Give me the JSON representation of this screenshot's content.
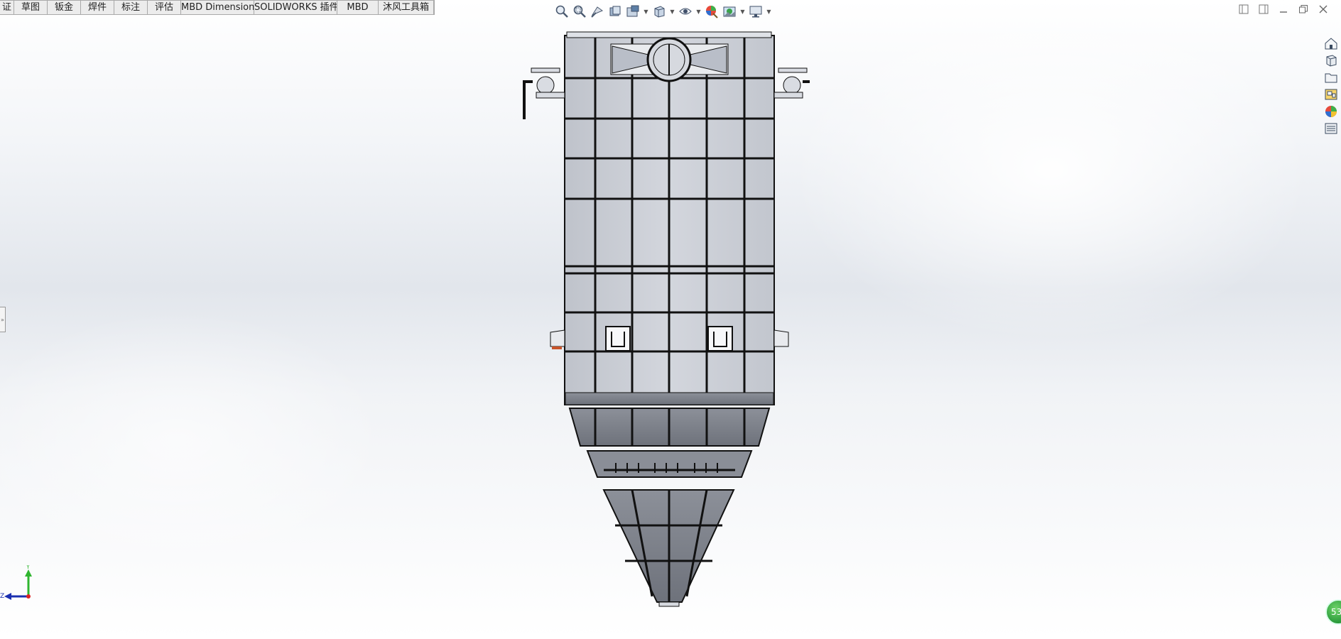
{
  "command_tabs": [
    {
      "label": "证",
      "width": 20
    },
    {
      "label": "草图",
      "width": 47
    },
    {
      "label": "钣金",
      "width": 47
    },
    {
      "label": "焊件",
      "width": 47
    },
    {
      "label": "标注",
      "width": 47
    },
    {
      "label": "评估",
      "width": 47
    },
    {
      "label": "MBD Dimensions",
      "width": 103
    },
    {
      "label": "SOLIDWORKS 插件",
      "width": 117
    },
    {
      "label": "MBD",
      "width": 58
    },
    {
      "label": "沐风工具箱",
      "width": 78
    }
  ],
  "view_toolbar": {
    "icons": [
      "zoom-to-fit-icon",
      "zoom-to-area-icon",
      "previous-view-icon",
      "section-view-icon",
      "dynamic-annotation-icon",
      "view-orientation-icon",
      "display-style-icon",
      "hide-show-items-icon",
      "edit-appearance-icon",
      "apply-scene-icon",
      "view-settings-icon"
    ]
  },
  "window_controls": [
    "restore-left-icon",
    "restore-right-icon",
    "minimize-icon",
    "maximize-icon",
    "close-icon"
  ],
  "task_pane": [
    "solidworks-resources-icon",
    "design-library-icon",
    "file-explorer-icon",
    "view-palette-icon",
    "appearances-icon",
    "custom-properties-icon"
  ],
  "triad": {
    "y_label": "Y",
    "z_label": "Z"
  },
  "status_badge": {
    "text": "53"
  },
  "colors": {
    "accent_tab_border": "#a9a9a9",
    "model_panel": "#c9ccd3",
    "model_dark_panel": "#7c8089",
    "triad_y": "#2fb52f",
    "triad_z": "#1a2fb0"
  }
}
